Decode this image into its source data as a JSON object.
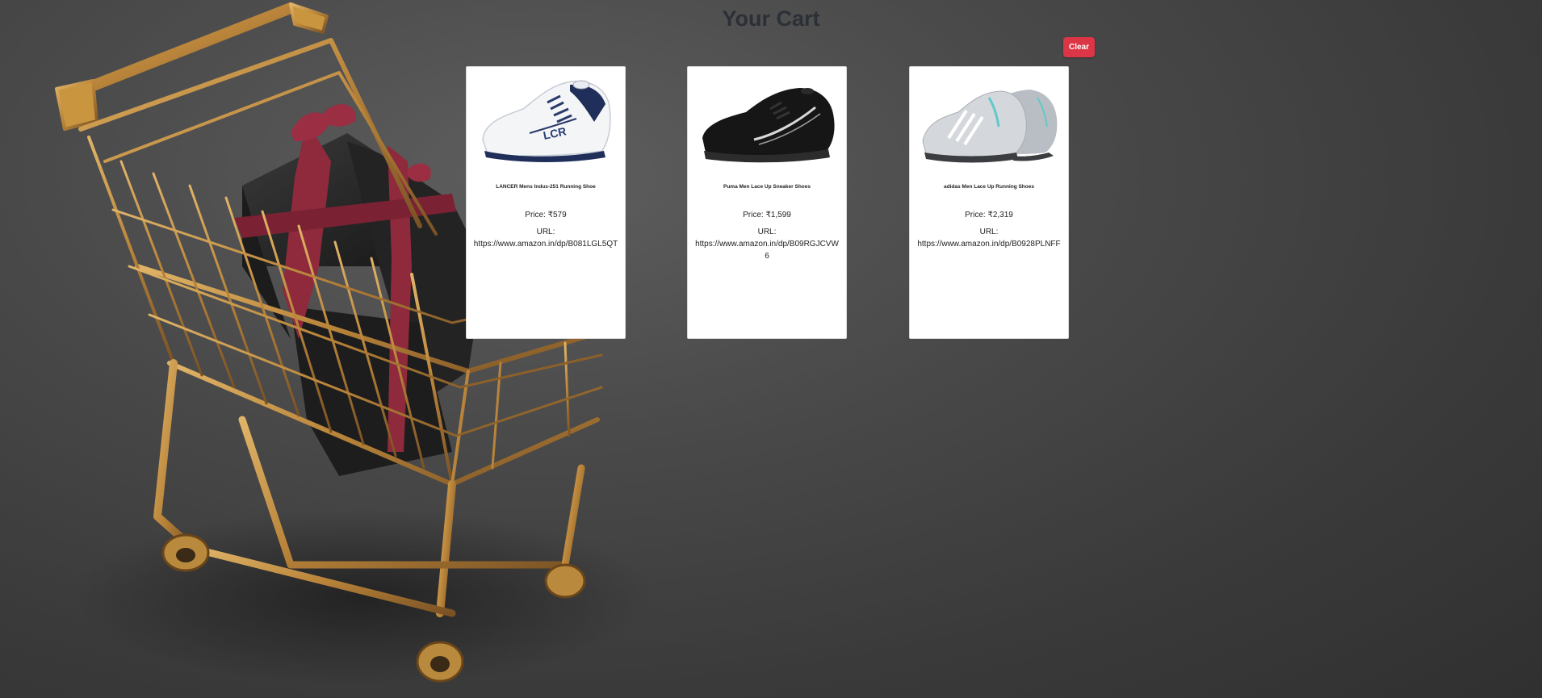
{
  "page": {
    "title": "Your Cart",
    "clear_label": "Clear",
    "accent_color": "#dc3545",
    "background_image": "shopping-cart-with-gift-boxes"
  },
  "cart": {
    "items": [
      {
        "name": "LANCER Mens Indus-251 Running Shoe",
        "price": "Price: ₹579",
        "url_label": "URL:",
        "url": "https://www.amazon.in/dp/B081LGL5QT",
        "image": "white-running-shoe-image"
      },
      {
        "name": "Puma Men Lace Up Sneaker Shoes",
        "price": "Price: ₹1,599",
        "url_label": "URL:",
        "url": "https://www.amazon.in/dp/B09RGJCVW6",
        "image": "black-sneaker-shoe-image"
      },
      {
        "name": "adidas Men Lace Up Running Shoes",
        "price": "Price: ₹2,319",
        "url_label": "URL:",
        "url": "https://www.amazon.in/dp/B0928PLNFF",
        "image": "grey-running-shoe-image"
      }
    ]
  }
}
